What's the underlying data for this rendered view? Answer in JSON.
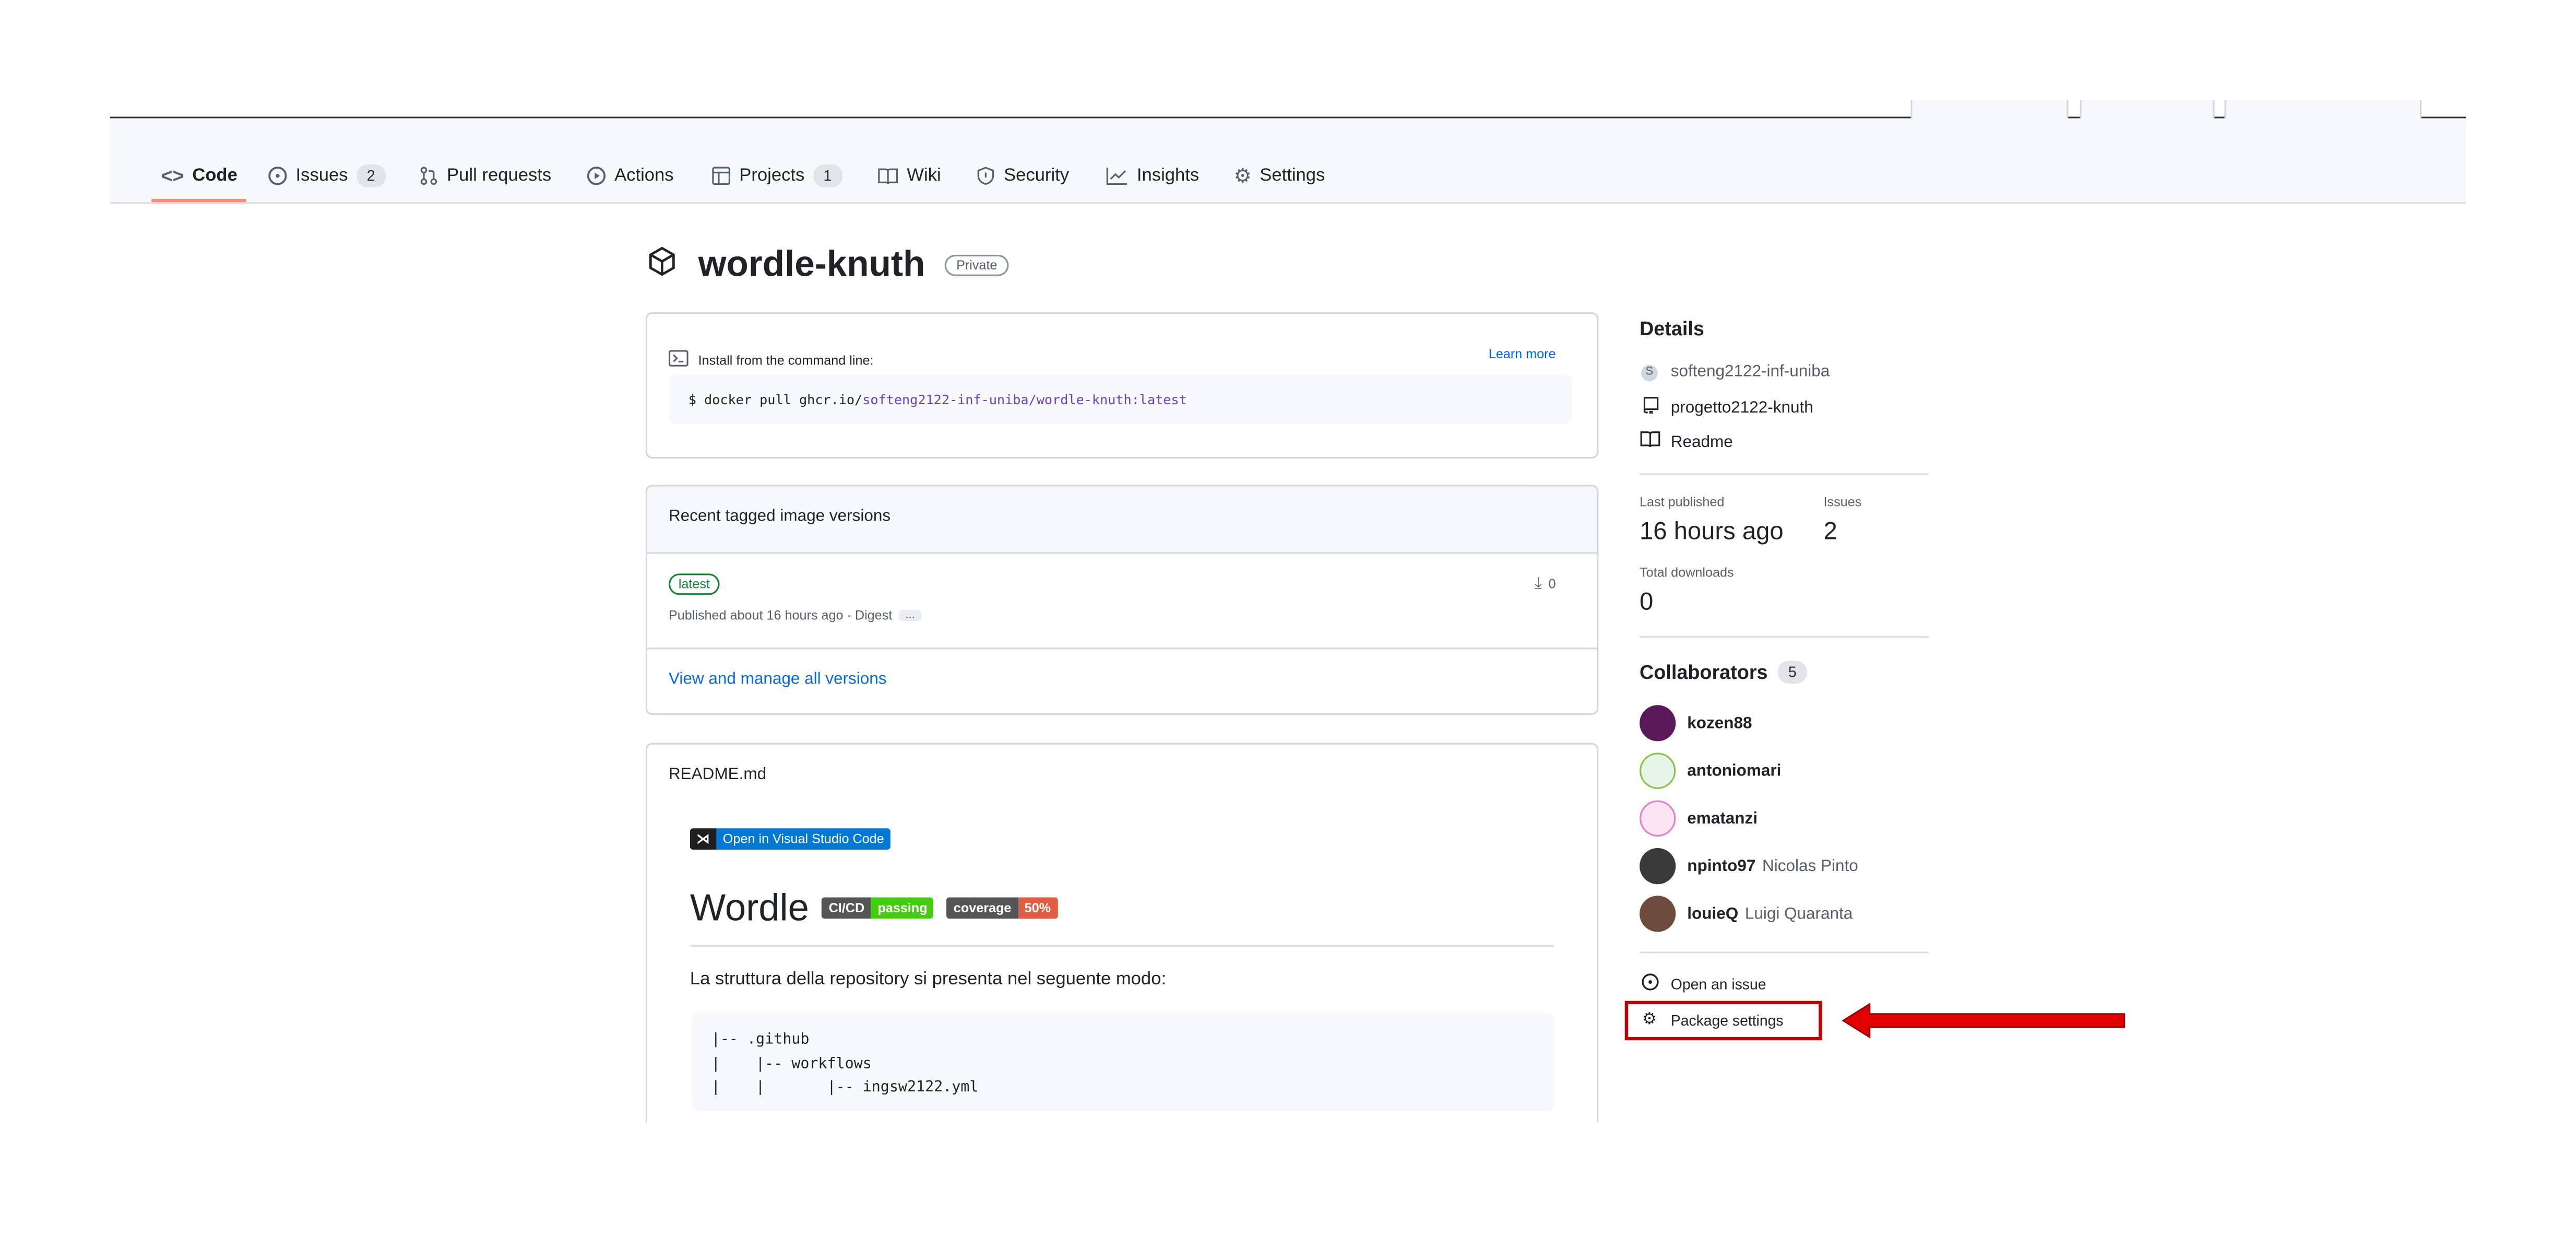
{
  "nav": {
    "items": [
      {
        "icon": "code-icon",
        "label": "Code"
      },
      {
        "icon": "issue-icon",
        "label": "Issues",
        "count": "2"
      },
      {
        "icon": "pull-request-icon",
        "label": "Pull requests"
      },
      {
        "icon": "actions-icon",
        "label": "Actions"
      },
      {
        "icon": "projects-icon",
        "label": "Projects",
        "count": "1"
      },
      {
        "icon": "wiki-icon",
        "label": "Wiki"
      },
      {
        "icon": "security-icon",
        "label": "Security"
      },
      {
        "icon": "insights-icon",
        "label": "Insights"
      },
      {
        "icon": "gear-icon",
        "label": "Settings"
      }
    ]
  },
  "package": {
    "name": "wordle-knuth",
    "visibility": "Private"
  },
  "install": {
    "label": "Install from the command line:",
    "learn_more": "Learn more",
    "cmd_prefix": "$ docker pull ghcr.io/",
    "cmd_highlight": "softeng2122-inf-uniba/wordle-knuth:latest"
  },
  "versions": {
    "header": "Recent tagged image versions",
    "tag": "latest",
    "published": "Published about 16 hours ago · Digest",
    "digest_btn": "...",
    "downloads": "0",
    "view_all": "View and manage all versions"
  },
  "readme": {
    "filename": "README.md",
    "vscode_badge": "Open in Visual Studio Code",
    "heading": "Wordle",
    "badge_cicd_left": "CI/CD",
    "badge_cicd_right": "passing",
    "badge_cov_left": "coverage",
    "badge_cov_right": "50%",
    "paragraph": "La struttura della repository si presenta nel seguente modo:",
    "code_lines": [
      "|-- .github",
      "|    |-- workflows",
      "|    |       |-- ingsw2122.yml"
    ]
  },
  "sidebar": {
    "details_title": "Details",
    "details": [
      {
        "icon": "org-icon",
        "text": "softeng2122-inf-uniba"
      },
      {
        "icon": "repo-icon",
        "text": "progetto2122-knuth"
      },
      {
        "icon": "book-icon",
        "text": "Readme"
      }
    ],
    "last_published_label": "Last published",
    "last_published_value": "16 hours ago",
    "issues_label": "Issues",
    "issues_value": "2",
    "total_downloads_label": "Total downloads",
    "total_downloads_value": "0",
    "collaborators_title": "Collaborators",
    "collaborators_count": "5",
    "collaborators": [
      {
        "login": "kozen88",
        "name": "",
        "color": "#5a1a5a"
      },
      {
        "login": "antoniomari",
        "name": "",
        "color": "#8bc34a"
      },
      {
        "login": "ematanzi",
        "name": "",
        "color": "#e57fc7"
      },
      {
        "login": "npinto97",
        "name": "Nicolas Pinto",
        "color": "#3a3a3a"
      },
      {
        "login": "louieQ",
        "name": "Luigi Quaranta",
        "color": "#6d4c3d"
      }
    ],
    "open_issue": "Open an issue",
    "package_settings": "Package settings"
  },
  "colors": {
    "annotation_red": "#c00000",
    "badge_green": "#4c1",
    "badge_orange": "#e05d44"
  }
}
